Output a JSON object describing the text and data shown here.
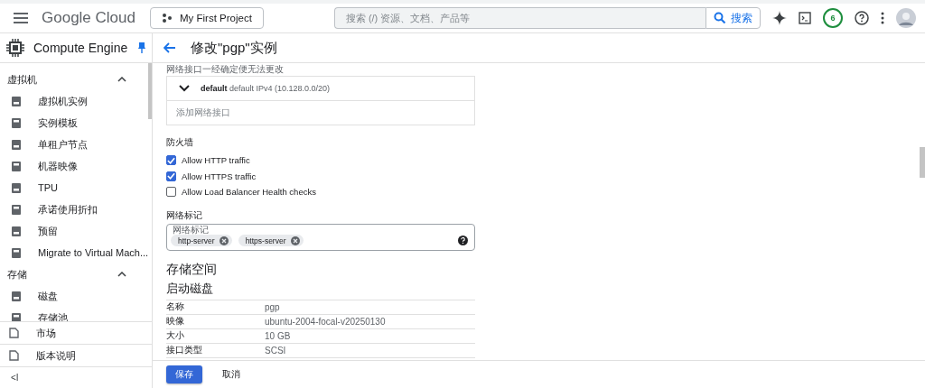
{
  "topbar": {
    "brand": "Google Cloud",
    "project": "My First Project",
    "search": {
      "placeholder": "搜索 (/) 资源、文档、产品等",
      "button": "搜索"
    },
    "notifications": "6"
  },
  "sidebar": {
    "title": "Compute Engine",
    "sections": [
      {
        "label": "虚拟机",
        "expanded": true,
        "items": [
          {
            "label": "虚拟机实例"
          },
          {
            "label": "实例模板"
          },
          {
            "label": "单租户节点"
          },
          {
            "label": "机器映像"
          },
          {
            "label": "TPU"
          },
          {
            "label": "承诺使用折扣"
          },
          {
            "label": "预留"
          },
          {
            "label": "Migrate to Virtual Mach..."
          }
        ]
      },
      {
        "label": "存储",
        "expanded": true,
        "items": [
          {
            "label": "磁盘"
          },
          {
            "label": "存储池"
          }
        ]
      }
    ],
    "bottom": [
      {
        "label": "市场"
      },
      {
        "label": "版本说明"
      }
    ],
    "collapse": "<I"
  },
  "page": {
    "title": "修改\"pgp\"实例",
    "network_note": "网络接口一经确定便无法更改",
    "interface": {
      "name": "default",
      "detail": "default IPv4 (10.128.0.0/20)",
      "add": "添加网络接口"
    },
    "firewall": {
      "label": "防火墙",
      "options": [
        {
          "label": "Allow HTTP traffic",
          "checked": true
        },
        {
          "label": "Allow HTTPS traffic",
          "checked": true
        },
        {
          "label": "Allow Load Balancer Health checks",
          "checked": false
        }
      ]
    },
    "tags": {
      "label": "网络标记",
      "field_label": "网络标记",
      "chips": [
        "http-server",
        "https-server"
      ]
    },
    "storage": {
      "title": "存储空间",
      "subtitle": "启动磁盘",
      "rows": [
        {
          "key": "名称",
          "value": "pgp"
        },
        {
          "key": "映像",
          "value": "ubuntu-2004-focal-v20250130"
        },
        {
          "key": "大小",
          "value": "10 GB"
        },
        {
          "key": "接口类型",
          "value": "SCSI"
        }
      ]
    }
  },
  "footer": {
    "save": "保存",
    "cancel": "取消"
  }
}
